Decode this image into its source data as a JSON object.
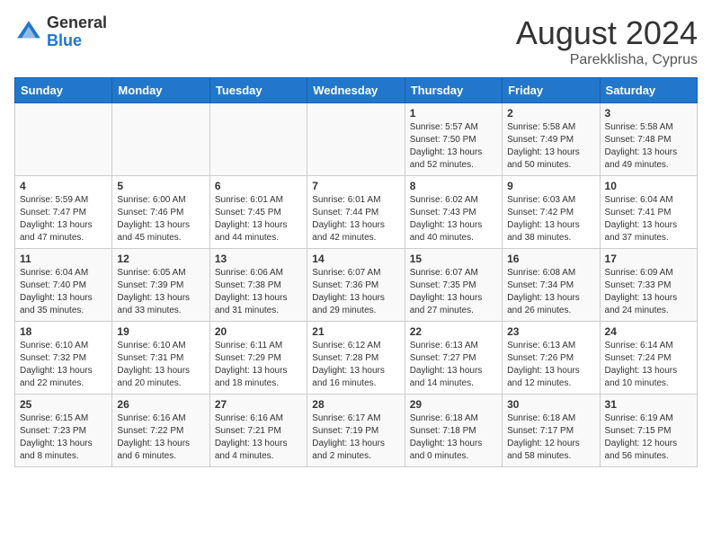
{
  "logo": {
    "general": "General",
    "blue": "Blue"
  },
  "title": "August 2024",
  "location": "Parekklisha, Cyprus",
  "days_of_week": [
    "Sunday",
    "Monday",
    "Tuesday",
    "Wednesday",
    "Thursday",
    "Friday",
    "Saturday"
  ],
  "weeks": [
    [
      {
        "day": "",
        "info": ""
      },
      {
        "day": "",
        "info": ""
      },
      {
        "day": "",
        "info": ""
      },
      {
        "day": "",
        "info": ""
      },
      {
        "day": "1",
        "info": "Sunrise: 5:57 AM\nSunset: 7:50 PM\nDaylight: 13 hours\nand 52 minutes."
      },
      {
        "day": "2",
        "info": "Sunrise: 5:58 AM\nSunset: 7:49 PM\nDaylight: 13 hours\nand 50 minutes."
      },
      {
        "day": "3",
        "info": "Sunrise: 5:58 AM\nSunset: 7:48 PM\nDaylight: 13 hours\nand 49 minutes."
      }
    ],
    [
      {
        "day": "4",
        "info": "Sunrise: 5:59 AM\nSunset: 7:47 PM\nDaylight: 13 hours\nand 47 minutes."
      },
      {
        "day": "5",
        "info": "Sunrise: 6:00 AM\nSunset: 7:46 PM\nDaylight: 13 hours\nand 45 minutes."
      },
      {
        "day": "6",
        "info": "Sunrise: 6:01 AM\nSunset: 7:45 PM\nDaylight: 13 hours\nand 44 minutes."
      },
      {
        "day": "7",
        "info": "Sunrise: 6:01 AM\nSunset: 7:44 PM\nDaylight: 13 hours\nand 42 minutes."
      },
      {
        "day": "8",
        "info": "Sunrise: 6:02 AM\nSunset: 7:43 PM\nDaylight: 13 hours\nand 40 minutes."
      },
      {
        "day": "9",
        "info": "Sunrise: 6:03 AM\nSunset: 7:42 PM\nDaylight: 13 hours\nand 38 minutes."
      },
      {
        "day": "10",
        "info": "Sunrise: 6:04 AM\nSunset: 7:41 PM\nDaylight: 13 hours\nand 37 minutes."
      }
    ],
    [
      {
        "day": "11",
        "info": "Sunrise: 6:04 AM\nSunset: 7:40 PM\nDaylight: 13 hours\nand 35 minutes."
      },
      {
        "day": "12",
        "info": "Sunrise: 6:05 AM\nSunset: 7:39 PM\nDaylight: 13 hours\nand 33 minutes."
      },
      {
        "day": "13",
        "info": "Sunrise: 6:06 AM\nSunset: 7:38 PM\nDaylight: 13 hours\nand 31 minutes."
      },
      {
        "day": "14",
        "info": "Sunrise: 6:07 AM\nSunset: 7:36 PM\nDaylight: 13 hours\nand 29 minutes."
      },
      {
        "day": "15",
        "info": "Sunrise: 6:07 AM\nSunset: 7:35 PM\nDaylight: 13 hours\nand 27 minutes."
      },
      {
        "day": "16",
        "info": "Sunrise: 6:08 AM\nSunset: 7:34 PM\nDaylight: 13 hours\nand 26 minutes."
      },
      {
        "day": "17",
        "info": "Sunrise: 6:09 AM\nSunset: 7:33 PM\nDaylight: 13 hours\nand 24 minutes."
      }
    ],
    [
      {
        "day": "18",
        "info": "Sunrise: 6:10 AM\nSunset: 7:32 PM\nDaylight: 13 hours\nand 22 minutes."
      },
      {
        "day": "19",
        "info": "Sunrise: 6:10 AM\nSunset: 7:31 PM\nDaylight: 13 hours\nand 20 minutes."
      },
      {
        "day": "20",
        "info": "Sunrise: 6:11 AM\nSunset: 7:29 PM\nDaylight: 13 hours\nand 18 minutes."
      },
      {
        "day": "21",
        "info": "Sunrise: 6:12 AM\nSunset: 7:28 PM\nDaylight: 13 hours\nand 16 minutes."
      },
      {
        "day": "22",
        "info": "Sunrise: 6:13 AM\nSunset: 7:27 PM\nDaylight: 13 hours\nand 14 minutes."
      },
      {
        "day": "23",
        "info": "Sunrise: 6:13 AM\nSunset: 7:26 PM\nDaylight: 13 hours\nand 12 minutes."
      },
      {
        "day": "24",
        "info": "Sunrise: 6:14 AM\nSunset: 7:24 PM\nDaylight: 13 hours\nand 10 minutes."
      }
    ],
    [
      {
        "day": "25",
        "info": "Sunrise: 6:15 AM\nSunset: 7:23 PM\nDaylight: 13 hours\nand 8 minutes."
      },
      {
        "day": "26",
        "info": "Sunrise: 6:16 AM\nSunset: 7:22 PM\nDaylight: 13 hours\nand 6 minutes."
      },
      {
        "day": "27",
        "info": "Sunrise: 6:16 AM\nSunset: 7:21 PM\nDaylight: 13 hours\nand 4 minutes."
      },
      {
        "day": "28",
        "info": "Sunrise: 6:17 AM\nSunset: 7:19 PM\nDaylight: 13 hours\nand 2 minutes."
      },
      {
        "day": "29",
        "info": "Sunrise: 6:18 AM\nSunset: 7:18 PM\nDaylight: 13 hours\nand 0 minutes."
      },
      {
        "day": "30",
        "info": "Sunrise: 6:18 AM\nSunset: 7:17 PM\nDaylight: 12 hours\nand 58 minutes."
      },
      {
        "day": "31",
        "info": "Sunrise: 6:19 AM\nSunset: 7:15 PM\nDaylight: 12 hours\nand 56 minutes."
      }
    ]
  ]
}
